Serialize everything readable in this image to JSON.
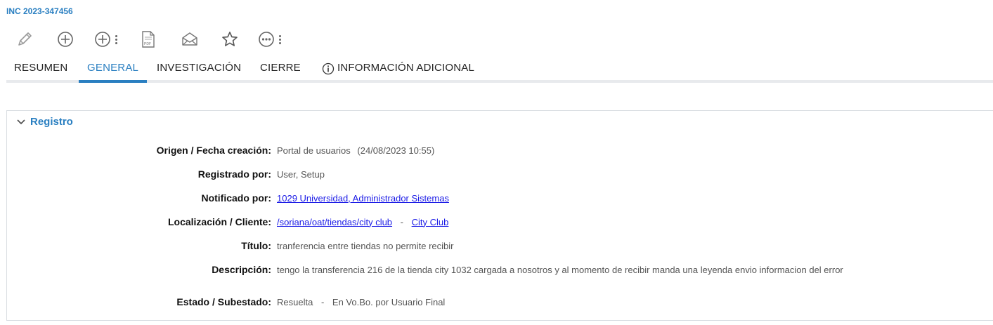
{
  "incident": {
    "id": "INC 2023-347456"
  },
  "toolbar": {
    "buttons": [
      {
        "icon": "pencil-icon"
      },
      {
        "icon": "plus-circle-icon"
      },
      {
        "icon": "plus-circle-more-icon"
      },
      {
        "icon": "pdf-icon"
      },
      {
        "icon": "envelope-icon"
      },
      {
        "icon": "star-icon"
      },
      {
        "icon": "more-options-icon"
      }
    ]
  },
  "tabs": [
    {
      "label": "RESUMEN",
      "active": false
    },
    {
      "label": "GENERAL",
      "active": true
    },
    {
      "label": "INVESTIGACIÓN",
      "active": false
    },
    {
      "label": "CIERRE",
      "active": false
    },
    {
      "label": "INFORMACIÓN ADICIONAL",
      "active": false,
      "icon": "info-icon"
    }
  ],
  "colors": {
    "accent": "#2a7fc1",
    "link": "#1a1ae6",
    "label": "#111111",
    "value": "#555555"
  },
  "registro": {
    "title": "Registro",
    "fields": {
      "origen": {
        "label": "Origen / Fecha creación:",
        "value": "Portal de usuarios",
        "date": "(24/08/2023 10:55)"
      },
      "registrado": {
        "label": "Registrado por:",
        "value": "User, Setup"
      },
      "notificado": {
        "label": "Notificado por:",
        "link": "1029 Universidad, Administrador Sistemas"
      },
      "localizacion": {
        "label": "Localización / Cliente:",
        "link": "/soriana/oat/tiendas/city club",
        "separator": "-",
        "client_link": "City Club"
      },
      "titulo": {
        "label": "Título:",
        "value": "tranferencia entre tiendas no permite recibir"
      },
      "descripcion": {
        "label": "Descripción:",
        "value": "tengo la transferencia 216 de la tienda city 1032 cargada a nosotros y al momento de recibir manda una leyenda envio informacion del error"
      },
      "estado": {
        "label": "Estado / Subestado:",
        "value": "Resuelta",
        "separator": "-",
        "subvalue": "En Vo.Bo. por Usuario Final"
      }
    }
  }
}
